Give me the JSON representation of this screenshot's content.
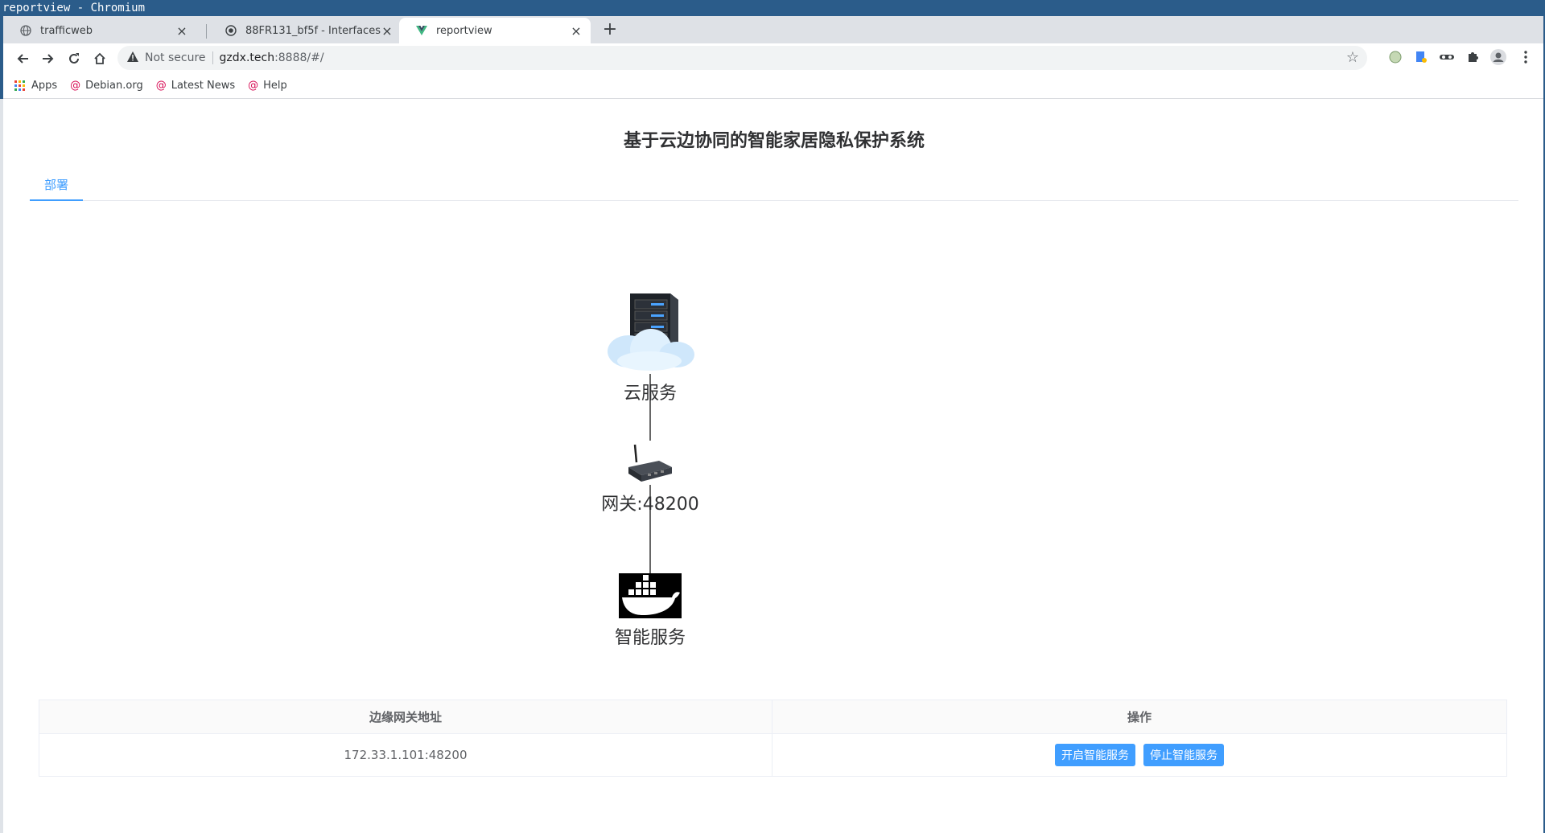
{
  "window": {
    "title": "reportview - Chromium"
  },
  "tabs": [
    {
      "label": "trafficweb",
      "icon": "globe-icon"
    },
    {
      "label": "88FR131_bf5f - Interfaces",
      "icon": "camera-icon"
    },
    {
      "label": "reportview",
      "icon": "vue-icon"
    }
  ],
  "toolbar": {
    "security": "Not secure",
    "url_host": "gzdx.tech",
    "url_rest": ":8888/#/"
  },
  "bookmarks": [
    {
      "label": "Apps"
    },
    {
      "label": "Debian.org"
    },
    {
      "label": "Latest News"
    },
    {
      "label": "Help"
    }
  ],
  "page": {
    "title": "基于云边协同的智能家居隐私保护系统",
    "tab": "部署"
  },
  "topology": {
    "cloud_label": "云服务",
    "gateway_label": "网关:48200",
    "service_label": "智能服务"
  },
  "table": {
    "headers": [
      "边缘网关地址",
      "操作"
    ],
    "rows": [
      {
        "address": "172.33.1.101:48200",
        "start_label": "开启智能服务",
        "stop_label": "停止智能服务"
      }
    ]
  },
  "colors": {
    "accent": "#409eff",
    "title_bar": "#2b5c8a"
  }
}
